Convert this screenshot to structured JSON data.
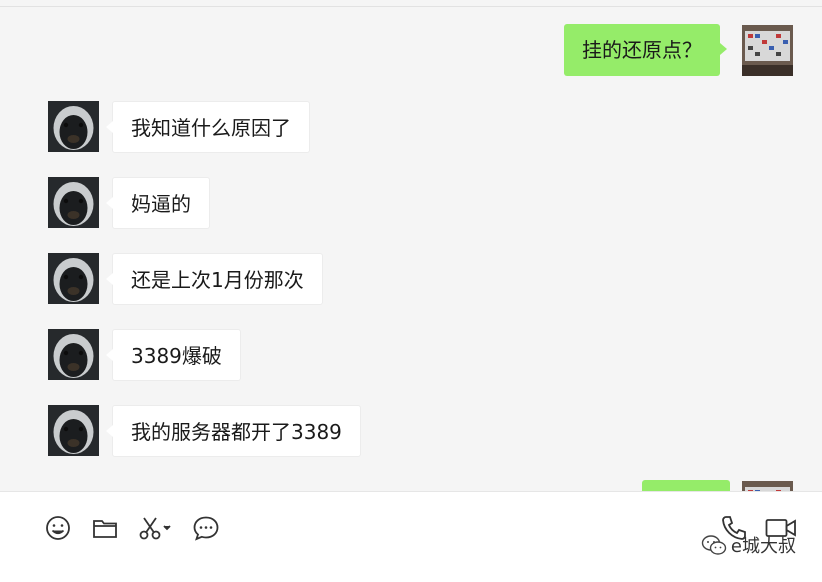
{
  "chat": {
    "messages": [
      {
        "side": "out",
        "text": "挂的还原点？"
      },
      {
        "side": "in",
        "text": "我知道什么原因了"
      },
      {
        "side": "in",
        "text": "妈逼的"
      },
      {
        "side": "in",
        "text": "还是上次1月份那次"
      },
      {
        "side": "in",
        "text": "3389爆破"
      },
      {
        "side": "in",
        "text": "我的服务器都开了3389"
      },
      {
        "side": "out",
        "text": ""
      }
    ]
  },
  "toolbar": {
    "icons": [
      "emoji-icon",
      "folder-icon",
      "scissors-icon",
      "chat-bubble-icon",
      "phone-icon",
      "video-icon"
    ]
  },
  "watermark": {
    "text": "e城大叔"
  },
  "colors": {
    "outgoing_bubble": "#95ec69",
    "incoming_bubble": "#ffffff",
    "background": "#f5f5f5"
  }
}
